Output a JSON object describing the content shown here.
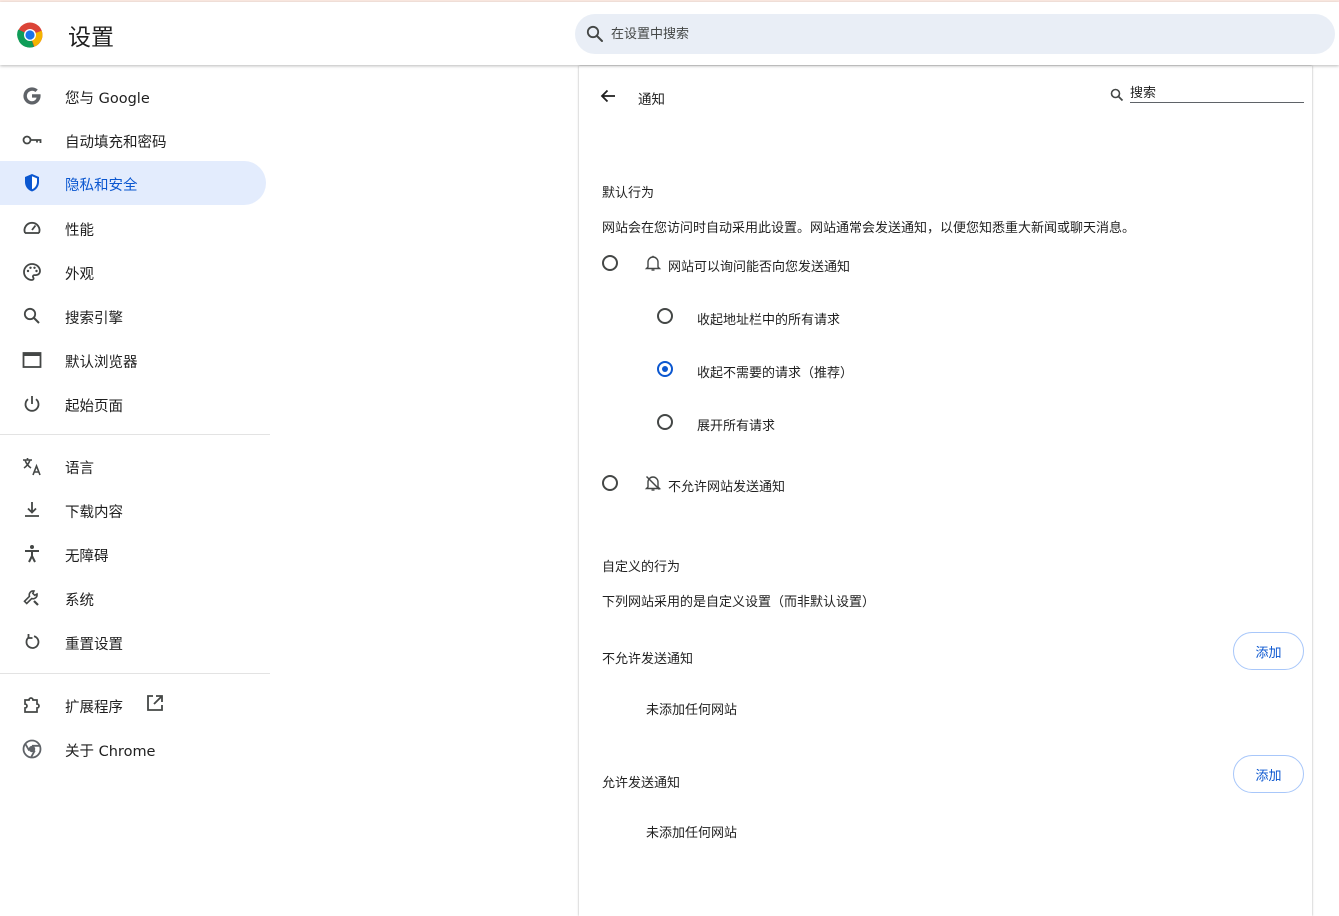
{
  "header": {
    "title": "设置",
    "search_placeholder": "在设置中搜索"
  },
  "sidebar": {
    "items": [
      {
        "label": "您与 Google",
        "icon": "google-g-icon"
      },
      {
        "label": "自动填充和密码",
        "icon": "key-icon"
      },
      {
        "label": "隐私和安全",
        "icon": "shield-icon",
        "active": true
      },
      {
        "label": "性能",
        "icon": "speedometer-icon"
      },
      {
        "label": "外观",
        "icon": "palette-icon"
      },
      {
        "label": "搜索引擎",
        "icon": "search-icon"
      },
      {
        "label": "默认浏览器",
        "icon": "browser-window-icon"
      },
      {
        "label": "起始页面",
        "icon": "power-icon"
      },
      {
        "label": "语言",
        "icon": "translate-icon"
      },
      {
        "label": "下载内容",
        "icon": "download-icon"
      },
      {
        "label": "无障碍",
        "icon": "accessibility-icon"
      },
      {
        "label": "系统",
        "icon": "wrench-icon"
      },
      {
        "label": "重置设置",
        "icon": "reset-icon"
      },
      {
        "label": "扩展程序",
        "icon": "puzzle-icon"
      },
      {
        "label": "关于 Chrome",
        "icon": "chrome-icon"
      }
    ]
  },
  "main": {
    "title": "通知",
    "search_placeholder": "搜索",
    "default_behavior": {
      "heading": "默认行为",
      "description": "网站会在您访问时自动采用此设置。网站通常会发送通知，以便您知悉重大新闻或聊天消息。",
      "options": [
        {
          "label": "网站可以询问能否向您发送通知",
          "checked": false
        },
        {
          "label": "不允许网站发送通知",
          "checked": false
        }
      ],
      "sub_options": [
        {
          "label": "收起地址栏中的所有请求",
          "checked": false
        },
        {
          "label": "收起不需要的请求（推荐）",
          "checked": true
        },
        {
          "label": "展开所有请求",
          "checked": false
        }
      ]
    },
    "custom_behavior": {
      "heading": "自定义的行为",
      "description": "下列网站采用的是自定义设置（而非默认设置）",
      "blocked": {
        "label": "不允许发送通知",
        "button": "添加",
        "empty": "未添加任何网站"
      },
      "allowed": {
        "label": "允许发送通知",
        "button": "添加",
        "empty": "未添加任何网站"
      }
    }
  },
  "colors": {
    "accent": "#0b57d0",
    "active_bg": "#e3ecfd",
    "search_bg": "#e9eef6"
  }
}
